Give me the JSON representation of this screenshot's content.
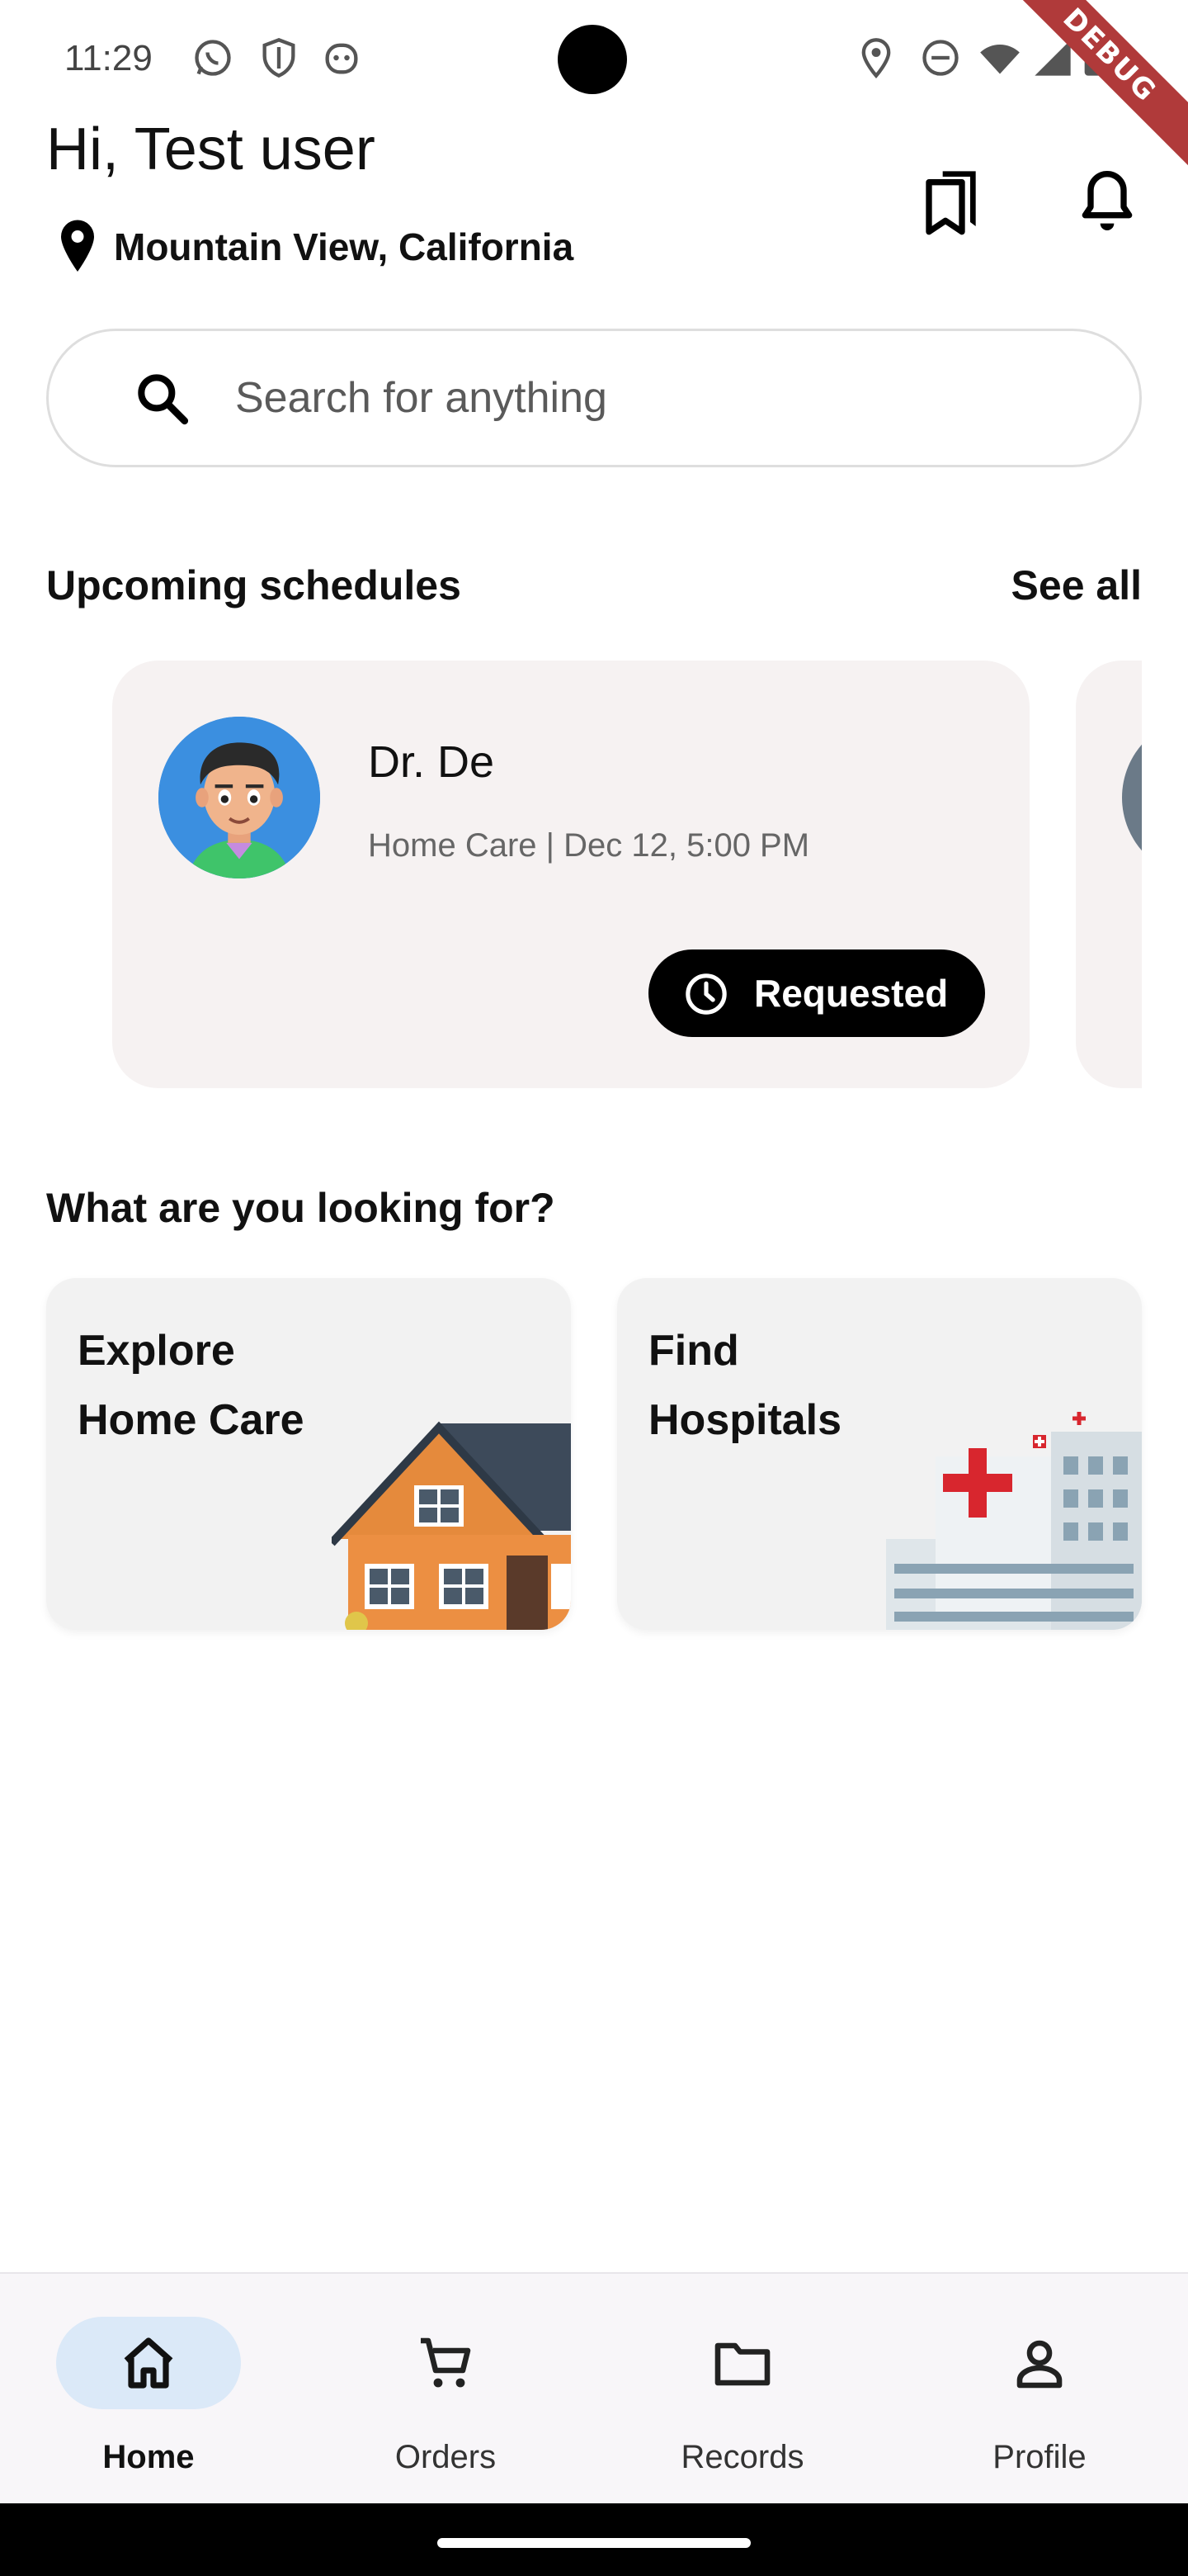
{
  "status_bar": {
    "time": "11:29",
    "debug_label": "DEBUG"
  },
  "header": {
    "greeting": "Hi, Test user",
    "location": "Mountain View, California"
  },
  "search": {
    "placeholder": "Search for anything"
  },
  "schedules": {
    "title": "Upcoming schedules",
    "see_all": "See all",
    "cards": [
      {
        "doctor": "Dr. De",
        "meta": "Home Care | Dec 12, 5:00 PM",
        "status": "Requested"
      }
    ]
  },
  "categories": {
    "title": "What are you looking for?",
    "items": [
      {
        "line1": "Explore",
        "line2": "Home Care"
      },
      {
        "line1": "Find",
        "line2": "Hospitals"
      }
    ]
  },
  "bottom_nav": {
    "items": [
      {
        "label": "Home",
        "icon": "home-icon",
        "active": true
      },
      {
        "label": "Orders",
        "icon": "cart-icon",
        "active": false
      },
      {
        "label": "Records",
        "icon": "folder-icon",
        "active": false
      },
      {
        "label": "Profile",
        "icon": "person-icon",
        "active": false
      }
    ]
  },
  "colors": {
    "accent_pill": "#dbe9f8",
    "card_bg": "#f6f2f2",
    "status_pill": "#000000",
    "debug_ribbon": "#b03a3a"
  }
}
